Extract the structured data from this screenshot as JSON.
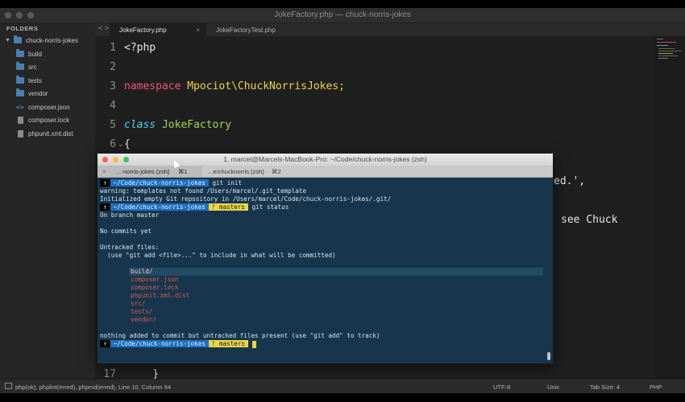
{
  "window": {
    "title": "JokeFactory.php — chuck-norris-jokes"
  },
  "sidebar": {
    "header": "FOLDERS",
    "root": "chuck-norris-jokes",
    "items": [
      {
        "label": "build",
        "type": "folder"
      },
      {
        "label": "src",
        "type": "folder"
      },
      {
        "label": "tests",
        "type": "folder"
      },
      {
        "label": "vendor",
        "type": "folder"
      },
      {
        "label": "composer.json",
        "type": "json"
      },
      {
        "label": "composer.lock",
        "type": "file"
      },
      {
        "label": "phpunit.xml.dist",
        "type": "file"
      }
    ]
  },
  "tabs": {
    "nav": "< >",
    "items": [
      {
        "label": "JokeFactory.php",
        "close": "×"
      },
      {
        "label": "JokeFactoryTest.php"
      }
    ]
  },
  "editor": {
    "lines": [
      {
        "num": "1",
        "text": "<?php"
      },
      {
        "num": "2",
        "text": ""
      },
      {
        "num": "3",
        "kw": "namespace",
        "rest": " Mpociot\\ChuckNorrisJokes;"
      },
      {
        "num": "4",
        "text": ""
      },
      {
        "num": "5",
        "kw": "class",
        "rest": " JokeFactory"
      },
      {
        "num": "6",
        "text": "{"
      },
      {
        "num": "17",
        "text": "    }"
      }
    ],
    "partial_right_1": "ed.',",
    "partial_right_2": "see Chuck"
  },
  "terminal": {
    "title": "1. marcel@Marcels-MacBook-Pro: ~/Code/chuck-norris-jokes (zsh)",
    "tabs": [
      {
        "label": "…-norris-jokes (zsh)",
        "shortcut": "⌘1",
        "close": "×"
      },
      {
        "label": "…e/chucknorris (zsh)",
        "shortcut": "⌘2",
        "close": "×"
      }
    ],
    "prompt_root": "↑",
    "prompt_path": "~/Code/chuck-norris-jokes",
    "prompt_git": "ᚠ master±",
    "lines": {
      "cmd1": "git init",
      "warn": "warning: templates not found /Users/marcel/.git_template",
      "init": "Initialized empty Git repository in /Users/marcel/Code/chuck-norris-jokes/.git/",
      "cmd2": "git status",
      "branch": "On branch master",
      "nocommits": "No commits yet",
      "untracked": "Untracked files:",
      "hint": "  (use \"git add <file>...\" to include in what will be committed)",
      "nothing": "nothing added to commit but untracked files present (use \"git add\" to track)"
    },
    "untracked_files": [
      "build/",
      "composer.json",
      "composer.lock",
      "phpunit.xml.dist",
      "src/",
      "tests/",
      "vendor/"
    ]
  },
  "status_bar": {
    "left": "php(ok), phplint(erred), phpmd(erred), Line 10, Column 94",
    "encoding": "UTF-8",
    "line_endings": "Unix",
    "tab_size": "Tab Size: 4",
    "syntax": "PHP"
  },
  "colors": {
    "keyword_pink": "#f0547a",
    "keyword_blue": "#5bc8e8",
    "class_green": "#9fd64a",
    "namespace_yellow": "#e8d54a",
    "terminal_bg": "#17364e",
    "untracked_red": "#e0584a"
  }
}
